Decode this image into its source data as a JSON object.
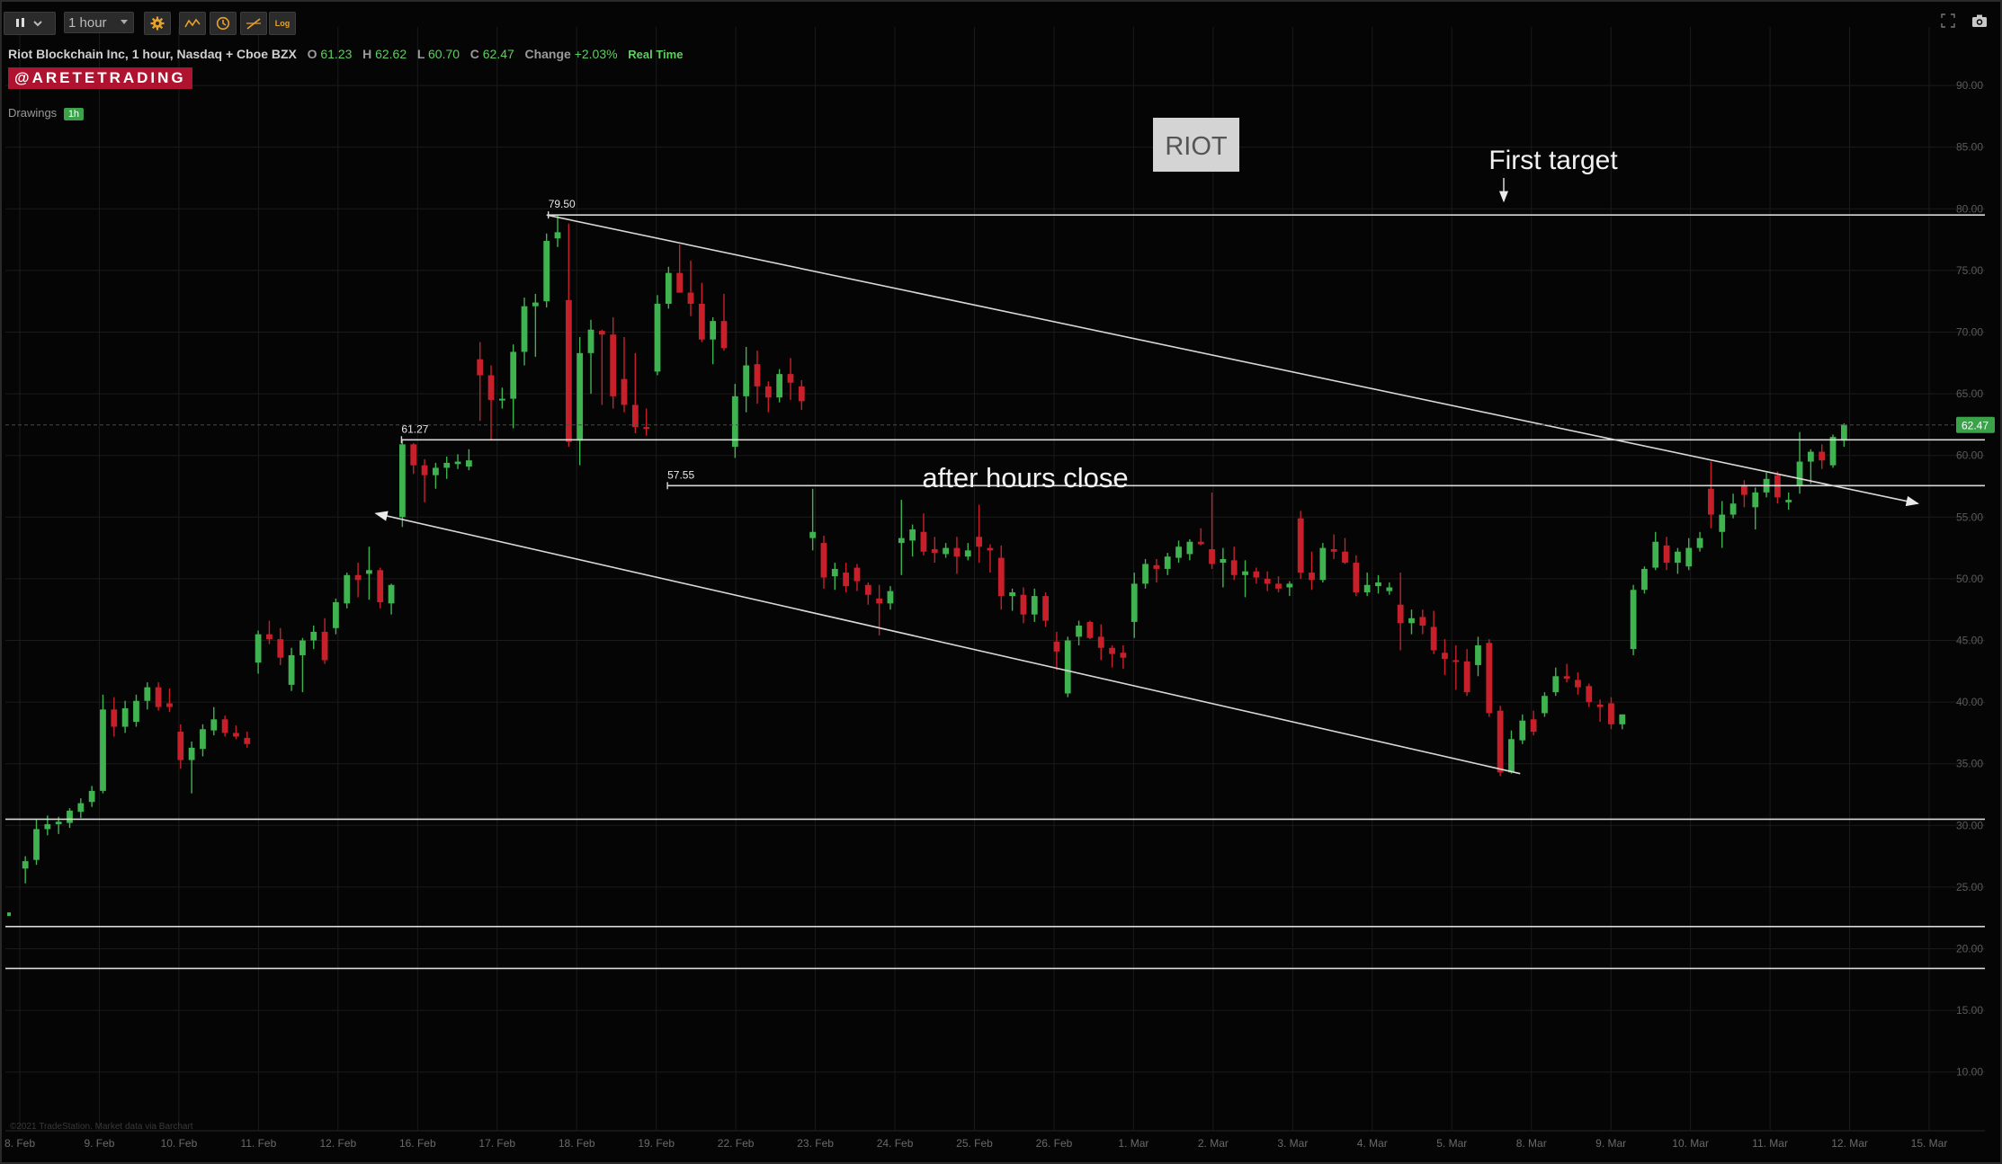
{
  "toolbar": {
    "chart_type_icon": "candlestick-icon",
    "timeframe": "1 hour",
    "settings_icon": "gear-icon",
    "studies_icon": "studies-icon",
    "clock_icon": "clock-icon",
    "drawing_icon": "drawing-tool-icon",
    "log_label": "Log",
    "fullscreen_icon": "fullscreen-icon",
    "camera_icon": "camera-icon"
  },
  "header": {
    "title": "Riot Blockchain Inc, 1 hour, Nasdaq + Cboe BZX",
    "o_label": "O",
    "o_value": "61.23",
    "h_label": "H",
    "h_value": "62.62",
    "l_label": "L",
    "l_value": "60.70",
    "c_label": "C",
    "c_value": "62.47",
    "change_label": "Change",
    "change_value": "+2.03%",
    "realtime": "Real Time",
    "brand": "@ARETETRADING",
    "drawings_label": "Drawings",
    "drawings_badge": "1h"
  },
  "footer": {
    "watermark": "©2021 TradeStation. Market data via Barchart"
  },
  "colors": {
    "up": "#3fb34f",
    "down": "#c8202a",
    "background": "#050505",
    "grid": "#1b1b1b",
    "price_tag": "#3aa34a"
  },
  "chart_data": {
    "type": "candlestick",
    "title": "Riot Blockchain Inc, 1 hour, Nasdaq + Cboe BZX",
    "xlabel": "",
    "ylabel": "",
    "ylim": [
      7.5,
      92.5
    ],
    "grid": true,
    "y_ticks": [
      "90.00",
      "85.00",
      "80.00",
      "75.00",
      "70.00",
      "65.00",
      "60.00",
      "55.00",
      "50.00",
      "45.00",
      "40.00",
      "35.00",
      "30.00",
      "25.00",
      "20.00",
      "15.00",
      "10.00"
    ],
    "y_tick_values": [
      90,
      85,
      80,
      75,
      70,
      65,
      60,
      55,
      50,
      45,
      40,
      35,
      30,
      25,
      20,
      15,
      10
    ],
    "x_labels": [
      "8. Feb",
      "9. Feb",
      "10. Feb",
      "11. Feb",
      "12. Feb",
      "16. Feb",
      "17. Feb",
      "18. Feb",
      "19. Feb",
      "22. Feb",
      "23. Feb",
      "24. Feb",
      "25. Feb",
      "26. Feb",
      "1. Mar",
      "2. Mar",
      "3. Mar",
      "4. Mar",
      "5. Mar",
      "8. Mar",
      "9. Mar",
      "10. Mar",
      "11. Mar",
      "12. Mar",
      "15. Mar"
    ],
    "last_price": "62.47",
    "last_price_value": 62.47,
    "candles": [
      {
        "o": 26.5,
        "h": 27.5,
        "l": 25.3,
        "c": 27.1
      },
      {
        "o": 27.2,
        "h": 30.5,
        "l": 26.8,
        "c": 29.7
      },
      {
        "o": 29.7,
        "h": 30.8,
        "l": 29.2,
        "c": 30.1
      },
      {
        "o": 30.1,
        "h": 30.7,
        "l": 29.3,
        "c": 30.3
      },
      {
        "o": 30.2,
        "h": 31.4,
        "l": 29.8,
        "c": 31.2
      },
      {
        "o": 31.1,
        "h": 32.2,
        "l": 30.6,
        "c": 31.8
      },
      {
        "o": 31.9,
        "h": 33.2,
        "l": 31.5,
        "c": 32.8
      },
      {
        "o": 32.8,
        "h": 40.6,
        "l": 32.6,
        "c": 39.4
      },
      {
        "o": 39.4,
        "h": 40.4,
        "l": 37.2,
        "c": 38.0
      },
      {
        "o": 38.0,
        "h": 40.1,
        "l": 37.5,
        "c": 39.5
      },
      {
        "o": 38.4,
        "h": 40.6,
        "l": 38.0,
        "c": 40.1
      },
      {
        "o": 40.1,
        "h": 41.6,
        "l": 39.4,
        "c": 41.2
      },
      {
        "o": 41.2,
        "h": 41.6,
        "l": 39.3,
        "c": 39.6
      },
      {
        "o": 39.9,
        "h": 41.1,
        "l": 39.2,
        "c": 39.6
      },
      {
        "o": 37.6,
        "h": 38.2,
        "l": 34.6,
        "c": 35.3
      },
      {
        "o": 35.3,
        "h": 36.8,
        "l": 32.6,
        "c": 36.3
      },
      {
        "o": 36.2,
        "h": 38.2,
        "l": 35.6,
        "c": 37.8
      },
      {
        "o": 37.7,
        "h": 39.6,
        "l": 37.3,
        "c": 38.6
      },
      {
        "o": 38.6,
        "h": 38.9,
        "l": 37.2,
        "c": 37.5
      },
      {
        "o": 37.5,
        "h": 38.1,
        "l": 37.0,
        "c": 37.2
      },
      {
        "o": 37.1,
        "h": 37.6,
        "l": 36.3,
        "c": 36.6
      },
      {
        "o": 43.2,
        "h": 45.8,
        "l": 42.3,
        "c": 45.5
      },
      {
        "o": 45.5,
        "h": 46.6,
        "l": 44.7,
        "c": 45.1
      },
      {
        "o": 45.1,
        "h": 46.0,
        "l": 43.0,
        "c": 43.6
      },
      {
        "o": 41.4,
        "h": 44.4,
        "l": 40.9,
        "c": 43.8
      },
      {
        "o": 43.8,
        "h": 45.2,
        "l": 40.8,
        "c": 45.0
      },
      {
        "o": 45.0,
        "h": 46.2,
        "l": 44.3,
        "c": 45.7
      },
      {
        "o": 45.7,
        "h": 46.8,
        "l": 43.1,
        "c": 43.4
      },
      {
        "o": 46.0,
        "h": 48.4,
        "l": 45.5,
        "c": 48.1
      },
      {
        "o": 48.0,
        "h": 50.5,
        "l": 47.6,
        "c": 50.3
      },
      {
        "o": 50.3,
        "h": 51.3,
        "l": 48.5,
        "c": 49.9
      },
      {
        "o": 50.4,
        "h": 52.6,
        "l": 48.3,
        "c": 50.7
      },
      {
        "o": 50.7,
        "h": 50.9,
        "l": 47.6,
        "c": 48.1
      },
      {
        "o": 48.0,
        "h": 49.6,
        "l": 47.1,
        "c": 49.5
      },
      {
        "o": 55.0,
        "h": 61.3,
        "l": 54.2,
        "c": 60.9
      },
      {
        "o": 60.9,
        "h": 61.0,
        "l": 58.5,
        "c": 59.2
      },
      {
        "o": 59.2,
        "h": 59.7,
        "l": 56.2,
        "c": 58.4
      },
      {
        "o": 58.4,
        "h": 59.4,
        "l": 57.3,
        "c": 59.0
      },
      {
        "o": 59.0,
        "h": 59.9,
        "l": 58.1,
        "c": 59.4
      },
      {
        "o": 59.3,
        "h": 60.1,
        "l": 58.9,
        "c": 59.5
      },
      {
        "o": 59.1,
        "h": 60.5,
        "l": 58.8,
        "c": 59.6
      },
      {
        "o": 67.8,
        "h": 69.2,
        "l": 62.8,
        "c": 66.5
      },
      {
        "o": 66.5,
        "h": 67.3,
        "l": 61.3,
        "c": 64.5
      },
      {
        "o": 64.5,
        "h": 65.5,
        "l": 63.8,
        "c": 64.6
      },
      {
        "o": 64.6,
        "h": 69.0,
        "l": 62.2,
        "c": 68.4
      },
      {
        "o": 68.4,
        "h": 72.8,
        "l": 67.3,
        "c": 72.1
      },
      {
        "o": 72.1,
        "h": 73.1,
        "l": 68.0,
        "c": 72.4
      },
      {
        "o": 72.5,
        "h": 78.0,
        "l": 72.0,
        "c": 77.4
      },
      {
        "o": 77.6,
        "h": 79.5,
        "l": 76.9,
        "c": 78.1
      },
      {
        "o": 72.6,
        "h": 78.8,
        "l": 60.7,
        "c": 61.1
      },
      {
        "o": 61.2,
        "h": 69.6,
        "l": 59.2,
        "c": 68.3
      },
      {
        "o": 68.3,
        "h": 71.0,
        "l": 65.0,
        "c": 70.2
      },
      {
        "o": 70.1,
        "h": 70.2,
        "l": 64.1,
        "c": 69.8
      },
      {
        "o": 69.8,
        "h": 71.2,
        "l": 63.8,
        "c": 64.8
      },
      {
        "o": 66.2,
        "h": 69.6,
        "l": 63.5,
        "c": 64.1
      },
      {
        "o": 64.1,
        "h": 68.3,
        "l": 61.8,
        "c": 62.3
      },
      {
        "o": 62.3,
        "h": 63.8,
        "l": 61.6,
        "c": 62.2
      },
      {
        "o": 66.8,
        "h": 73.0,
        "l": 66.5,
        "c": 72.3
      },
      {
        "o": 72.3,
        "h": 75.3,
        "l": 71.9,
        "c": 74.8
      },
      {
        "o": 74.8,
        "h": 77.1,
        "l": 73.4,
        "c": 73.2
      },
      {
        "o": 73.2,
        "h": 75.8,
        "l": 71.3,
        "c": 72.3
      },
      {
        "o": 72.3,
        "h": 74.0,
        "l": 69.2,
        "c": 69.4
      },
      {
        "o": 69.4,
        "h": 71.2,
        "l": 67.4,
        "c": 70.9
      },
      {
        "o": 70.9,
        "h": 73.1,
        "l": 68.5,
        "c": 68.7
      },
      {
        "o": 60.7,
        "h": 65.8,
        "l": 59.8,
        "c": 64.8
      },
      {
        "o": 64.8,
        "h": 68.8,
        "l": 63.5,
        "c": 67.3
      },
      {
        "o": 67.4,
        "h": 68.5,
        "l": 64.2,
        "c": 65.6
      },
      {
        "o": 65.6,
        "h": 66.0,
        "l": 63.5,
        "c": 64.7
      },
      {
        "o": 64.7,
        "h": 67.0,
        "l": 64.3,
        "c": 66.6
      },
      {
        "o": 66.6,
        "h": 67.9,
        "l": 64.5,
        "c": 65.9
      },
      {
        "o": 65.6,
        "h": 66.1,
        "l": 63.7,
        "c": 64.4
      },
      {
        "o": 53.3,
        "h": 57.3,
        "l": 52.3,
        "c": 53.8
      },
      {
        "o": 52.9,
        "h": 53.5,
        "l": 49.2,
        "c": 50.1
      },
      {
        "o": 50.2,
        "h": 51.3,
        "l": 49.1,
        "c": 50.8
      },
      {
        "o": 50.5,
        "h": 51.3,
        "l": 48.9,
        "c": 49.4
      },
      {
        "o": 50.9,
        "h": 51.2,
        "l": 49.0,
        "c": 49.8
      },
      {
        "o": 49.5,
        "h": 49.7,
        "l": 47.9,
        "c": 48.7
      },
      {
        "o": 48.4,
        "h": 49.5,
        "l": 45.4,
        "c": 48.0
      },
      {
        "o": 48.0,
        "h": 49.4,
        "l": 47.5,
        "c": 49.0
      },
      {
        "o": 52.9,
        "h": 56.4,
        "l": 50.3,
        "c": 53.3
      },
      {
        "o": 53.1,
        "h": 54.4,
        "l": 51.8,
        "c": 54.0
      },
      {
        "o": 53.8,
        "h": 55.3,
        "l": 51.9,
        "c": 52.2
      },
      {
        "o": 52.4,
        "h": 53.4,
        "l": 51.3,
        "c": 52.1
      },
      {
        "o": 52.0,
        "h": 52.9,
        "l": 51.7,
        "c": 52.5
      },
      {
        "o": 52.5,
        "h": 53.4,
        "l": 50.4,
        "c": 51.8
      },
      {
        "o": 51.8,
        "h": 52.9,
        "l": 51.5,
        "c": 52.3
      },
      {
        "o": 53.4,
        "h": 56.0,
        "l": 51.3,
        "c": 52.6
      },
      {
        "o": 52.5,
        "h": 52.8,
        "l": 50.5,
        "c": 52.3
      },
      {
        "o": 51.7,
        "h": 52.7,
        "l": 47.5,
        "c": 48.6
      },
      {
        "o": 48.6,
        "h": 49.2,
        "l": 47.4,
        "c": 48.9
      },
      {
        "o": 48.7,
        "h": 49.3,
        "l": 46.4,
        "c": 47.1
      },
      {
        "o": 47.1,
        "h": 49.2,
        "l": 46.5,
        "c": 48.6
      },
      {
        "o": 48.6,
        "h": 48.9,
        "l": 46.1,
        "c": 46.6
      },
      {
        "o": 44.9,
        "h": 45.7,
        "l": 42.6,
        "c": 44.1
      },
      {
        "o": 40.7,
        "h": 45.3,
        "l": 40.4,
        "c": 45.0
      },
      {
        "o": 45.3,
        "h": 46.6,
        "l": 44.6,
        "c": 46.2
      },
      {
        "o": 46.5,
        "h": 46.6,
        "l": 45.1,
        "c": 45.2
      },
      {
        "o": 45.3,
        "h": 46.3,
        "l": 43.4,
        "c": 44.4
      },
      {
        "o": 44.4,
        "h": 44.6,
        "l": 42.8,
        "c": 43.9
      },
      {
        "o": 44.0,
        "h": 44.6,
        "l": 42.7,
        "c": 43.6
      },
      {
        "o": 46.5,
        "h": 50.5,
        "l": 45.2,
        "c": 49.6
      },
      {
        "o": 49.6,
        "h": 51.6,
        "l": 49.2,
        "c": 51.2
      },
      {
        "o": 51.1,
        "h": 51.6,
        "l": 49.7,
        "c": 50.8
      },
      {
        "o": 50.8,
        "h": 52.1,
        "l": 50.3,
        "c": 51.8
      },
      {
        "o": 51.7,
        "h": 53.1,
        "l": 51.3,
        "c": 52.6
      },
      {
        "o": 52.0,
        "h": 53.2,
        "l": 51.5,
        "c": 53.0
      },
      {
        "o": 53.0,
        "h": 54.1,
        "l": 52.7,
        "c": 52.8
      },
      {
        "o": 52.4,
        "h": 57.0,
        "l": 50.8,
        "c": 51.2
      },
      {
        "o": 51.3,
        "h": 52.5,
        "l": 49.3,
        "c": 51.6
      },
      {
        "o": 51.5,
        "h": 52.6,
        "l": 49.9,
        "c": 50.3
      },
      {
        "o": 50.3,
        "h": 51.5,
        "l": 48.5,
        "c": 50.6
      },
      {
        "o": 50.6,
        "h": 50.9,
        "l": 49.6,
        "c": 50.1
      },
      {
        "o": 50.0,
        "h": 50.6,
        "l": 49.0,
        "c": 49.6
      },
      {
        "o": 49.6,
        "h": 50.2,
        "l": 48.9,
        "c": 49.2
      },
      {
        "o": 49.3,
        "h": 49.8,
        "l": 48.6,
        "c": 49.6
      },
      {
        "o": 54.9,
        "h": 55.5,
        "l": 50.0,
        "c": 50.5
      },
      {
        "o": 50.5,
        "h": 52.2,
        "l": 49.1,
        "c": 49.9
      },
      {
        "o": 49.9,
        "h": 52.9,
        "l": 49.7,
        "c": 52.5
      },
      {
        "o": 52.4,
        "h": 53.6,
        "l": 51.6,
        "c": 52.2
      },
      {
        "o": 52.2,
        "h": 53.3,
        "l": 51.2,
        "c": 51.3
      },
      {
        "o": 51.3,
        "h": 51.9,
        "l": 48.6,
        "c": 48.9
      },
      {
        "o": 48.9,
        "h": 50.5,
        "l": 48.6,
        "c": 49.5
      },
      {
        "o": 49.4,
        "h": 50.3,
        "l": 48.8,
        "c": 49.7
      },
      {
        "o": 49.0,
        "h": 49.7,
        "l": 48.7,
        "c": 49.3
      },
      {
        "o": 47.9,
        "h": 50.5,
        "l": 44.2,
        "c": 46.4
      },
      {
        "o": 46.4,
        "h": 47.5,
        "l": 45.5,
        "c": 46.8
      },
      {
        "o": 46.9,
        "h": 47.5,
        "l": 45.5,
        "c": 46.2
      },
      {
        "o": 46.1,
        "h": 47.4,
        "l": 43.9,
        "c": 44.2
      },
      {
        "o": 44.0,
        "h": 45.1,
        "l": 42.2,
        "c": 43.5
      },
      {
        "o": 43.4,
        "h": 44.6,
        "l": 41.0,
        "c": 43.3
      },
      {
        "o": 43.3,
        "h": 44.3,
        "l": 40.5,
        "c": 40.8
      },
      {
        "o": 43.0,
        "h": 45.3,
        "l": 42.1,
        "c": 44.6
      },
      {
        "o": 44.8,
        "h": 45.1,
        "l": 38.8,
        "c": 39.1
      },
      {
        "o": 39.3,
        "h": 39.7,
        "l": 34.0,
        "c": 34.3
      },
      {
        "o": 34.3,
        "h": 37.7,
        "l": 34.2,
        "c": 37.0
      },
      {
        "o": 36.9,
        "h": 39.0,
        "l": 36.6,
        "c": 38.5
      },
      {
        "o": 38.6,
        "h": 39.3,
        "l": 37.3,
        "c": 37.6
      },
      {
        "o": 39.1,
        "h": 40.8,
        "l": 38.8,
        "c": 40.5
      },
      {
        "o": 40.8,
        "h": 42.8,
        "l": 40.5,
        "c": 42.1
      },
      {
        "o": 42.1,
        "h": 43.1,
        "l": 41.6,
        "c": 41.9
      },
      {
        "o": 41.8,
        "h": 42.4,
        "l": 40.6,
        "c": 41.2
      },
      {
        "o": 41.3,
        "h": 41.5,
        "l": 39.6,
        "c": 40.0
      },
      {
        "o": 39.8,
        "h": 40.2,
        "l": 38.4,
        "c": 39.6
      },
      {
        "o": 39.9,
        "h": 40.4,
        "l": 37.8,
        "c": 38.2
      },
      {
        "o": 38.2,
        "h": 39.0,
        "l": 37.8,
        "c": 39.0
      },
      {
        "o": 44.3,
        "h": 49.5,
        "l": 43.8,
        "c": 49.1
      },
      {
        "o": 49.1,
        "h": 51.0,
        "l": 48.8,
        "c": 50.8
      },
      {
        "o": 50.9,
        "h": 53.8,
        "l": 50.7,
        "c": 53.0
      },
      {
        "o": 52.7,
        "h": 53.4,
        "l": 50.7,
        "c": 51.3
      },
      {
        "o": 51.3,
        "h": 52.5,
        "l": 50.4,
        "c": 52.2
      },
      {
        "o": 51.0,
        "h": 53.3,
        "l": 50.7,
        "c": 52.5
      },
      {
        "o": 52.5,
        "h": 53.8,
        "l": 52.2,
        "c": 53.3
      },
      {
        "o": 57.3,
        "h": 59.5,
        "l": 54.1,
        "c": 55.2
      },
      {
        "o": 53.8,
        "h": 56.3,
        "l": 52.5,
        "c": 55.2
      },
      {
        "o": 55.2,
        "h": 56.9,
        "l": 54.9,
        "c": 56.1
      },
      {
        "o": 57.5,
        "h": 58.0,
        "l": 55.8,
        "c": 56.8
      },
      {
        "o": 55.8,
        "h": 57.4,
        "l": 54.0,
        "c": 57.0
      },
      {
        "o": 57.0,
        "h": 58.6,
        "l": 56.6,
        "c": 58.1
      },
      {
        "o": 58.4,
        "h": 58.7,
        "l": 56.1,
        "c": 56.6
      },
      {
        "o": 56.2,
        "h": 57.0,
        "l": 55.6,
        "c": 56.4
      },
      {
        "o": 57.5,
        "h": 61.9,
        "l": 56.9,
        "c": 59.5
      },
      {
        "o": 59.5,
        "h": 60.5,
        "l": 57.7,
        "c": 60.3
      },
      {
        "o": 60.3,
        "h": 60.9,
        "l": 58.9,
        "c": 59.6
      },
      {
        "o": 59.2,
        "h": 61.7,
        "l": 59.0,
        "c": 61.5
      },
      {
        "o": 61.2,
        "h": 62.6,
        "l": 60.7,
        "c": 62.5
      }
    ],
    "annotations": [
      {
        "type": "hline",
        "y": 79.5,
        "x_start_label": "18. Feb",
        "label": "79.50"
      },
      {
        "type": "hline",
        "y": 61.27,
        "x_start_label": "16. Feb",
        "label": "61.27"
      },
      {
        "type": "hline",
        "y": 57.55,
        "x_start_label": "22. Feb",
        "label": "57.55"
      },
      {
        "type": "hline",
        "y": 30.5
      },
      {
        "type": "hline",
        "y": 21.8
      },
      {
        "type": "hline",
        "y": 18.4
      },
      {
        "type": "trendline",
        "from": {
          "x": "18. Feb",
          "y": 79.5
        },
        "to": {
          "x": "12. Mar",
          "y": 56.1
        },
        "arrow": "end"
      },
      {
        "type": "trendline",
        "from": {
          "x": "12. Feb",
          "y": 55.3
        },
        "to": {
          "x": "5. Mar",
          "y": 34.2
        },
        "arrow": "start"
      },
      {
        "type": "text",
        "text": "RIOT",
        "boxed": true
      },
      {
        "type": "text",
        "text": "First target",
        "arrow": "down"
      },
      {
        "type": "text",
        "text": "after hours close"
      }
    ]
  }
}
